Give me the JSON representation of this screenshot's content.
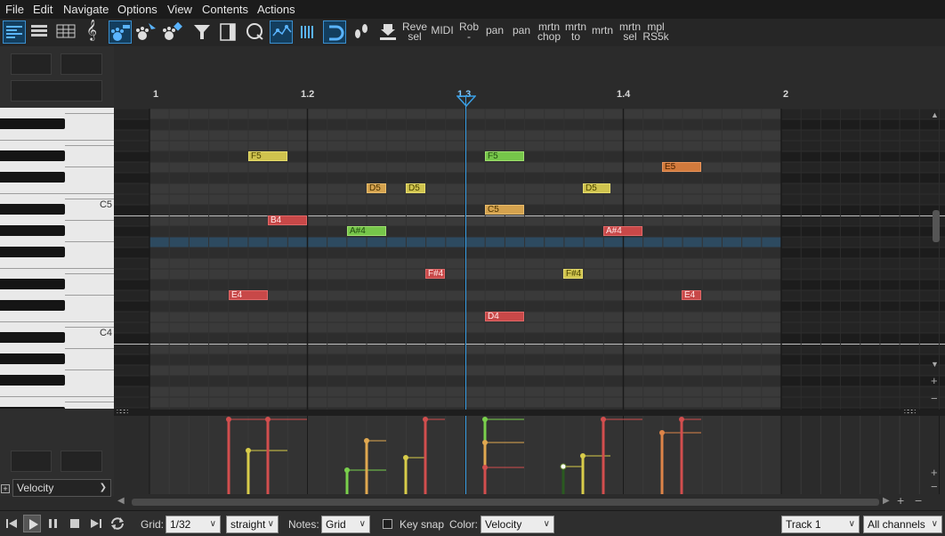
{
  "menu": [
    "File",
    "Edit",
    "Navigate",
    "Options",
    "View",
    "Contents",
    "Actions"
  ],
  "toolbar": {
    "labels": [
      {
        "name": "reve-sel",
        "text": "Reve\nsel"
      },
      {
        "name": "midi",
        "text": "MIDI"
      },
      {
        "name": "rob",
        "text": "Rob\n-"
      },
      {
        "name": "pan-1",
        "text": "pan"
      },
      {
        "name": "pan-2",
        "text": "pan"
      },
      {
        "name": "mrtn-chop",
        "text": "mrtn\nchop"
      },
      {
        "name": "mrtn-to",
        "text": "mrtn\nto"
      },
      {
        "name": "mrtn",
        "text": "mrtn"
      },
      {
        "name": "mrtn-sel",
        "text": "mrtn\nsel"
      },
      {
        "name": "mpl-rs5k",
        "text": "mpl\nRS5k"
      }
    ]
  },
  "keyboard": {
    "labels": [
      "C5",
      "C4"
    ]
  },
  "ruler": {
    "labels": [
      "1",
      "1.2",
      "1.3",
      "1.4",
      "2"
    ]
  },
  "notes": [
    {
      "label": "F5",
      "color": "yellow"
    },
    {
      "label": "B4",
      "color": "red"
    },
    {
      "label": "E4",
      "color": "red"
    },
    {
      "label": "A#4",
      "color": "green"
    },
    {
      "label": "D5",
      "color": "orange"
    },
    {
      "label": "D5",
      "color": "yellow"
    },
    {
      "label": "F#4",
      "color": "red"
    },
    {
      "label": "F5",
      "color": "green"
    },
    {
      "label": "C5",
      "color": "orange"
    },
    {
      "label": "D4",
      "color": "red"
    },
    {
      "label": "F#4",
      "color": "yellow"
    },
    {
      "label": "D5",
      "color": "yellow"
    },
    {
      "label": "A#4",
      "color": "red"
    },
    {
      "label": "E5",
      "color": "dorange"
    },
    {
      "label": "E4",
      "color": "red"
    }
  ],
  "colors": {
    "yellow": "#cfc34e",
    "red": "#c84848",
    "green": "#76c64a",
    "orange": "#d4a24e",
    "dorange": "#d27a3c",
    "playhead": "#3aa0e6",
    "highlight_row": "#2d4a60"
  },
  "lane": {
    "selected": "Velocity"
  },
  "status": {
    "grid_label": "Grid:",
    "grid_value": "1/32",
    "swing_value": "straight",
    "notes_label": "Notes:",
    "notes_value": "Grid",
    "keysnap_label": "Key snap",
    "color_label": "Color:",
    "color_value": "Velocity",
    "track_value": "Track 1",
    "channel_value": "All channels"
  }
}
